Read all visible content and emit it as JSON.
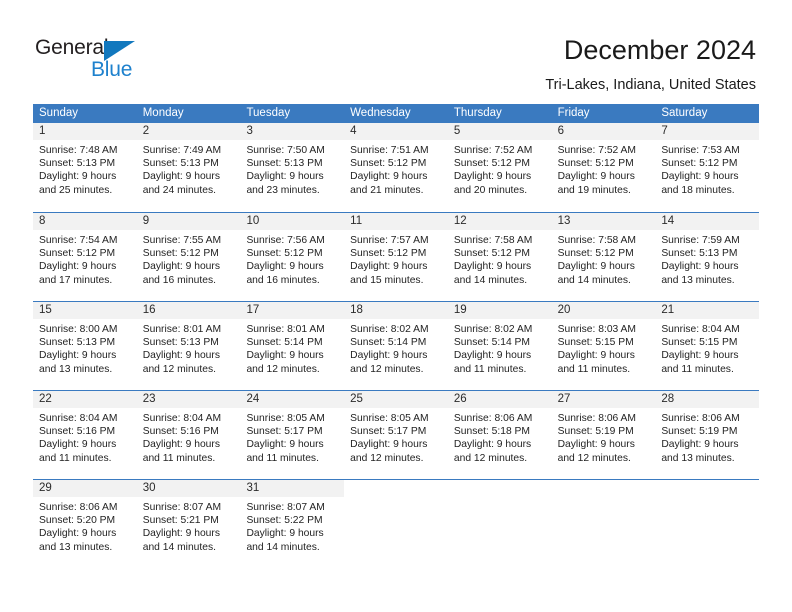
{
  "branding": {
    "name_part1": "General",
    "name_part2": "Blue"
  },
  "header": {
    "title": "December 2024",
    "subtitle": "Tri-Lakes, Indiana, United States"
  },
  "colors": {
    "header_blue": "#3a7ac0",
    "logo_blue": "#1e81cd",
    "daynum_band": "#f2f2f2"
  },
  "calendar": {
    "weekdays": [
      "Sunday",
      "Monday",
      "Tuesday",
      "Wednesday",
      "Thursday",
      "Friday",
      "Saturday"
    ],
    "weeks": [
      [
        {
          "day": "1",
          "sunrise": "Sunrise: 7:48 AM",
          "sunset": "Sunset: 5:13 PM",
          "daylight1": "Daylight: 9 hours",
          "daylight2": "and 25 minutes."
        },
        {
          "day": "2",
          "sunrise": "Sunrise: 7:49 AM",
          "sunset": "Sunset: 5:13 PM",
          "daylight1": "Daylight: 9 hours",
          "daylight2": "and 24 minutes."
        },
        {
          "day": "3",
          "sunrise": "Sunrise: 7:50 AM",
          "sunset": "Sunset: 5:13 PM",
          "daylight1": "Daylight: 9 hours",
          "daylight2": "and 23 minutes."
        },
        {
          "day": "4",
          "sunrise": "Sunrise: 7:51 AM",
          "sunset": "Sunset: 5:12 PM",
          "daylight1": "Daylight: 9 hours",
          "daylight2": "and 21 minutes."
        },
        {
          "day": "5",
          "sunrise": "Sunrise: 7:52 AM",
          "sunset": "Sunset: 5:12 PM",
          "daylight1": "Daylight: 9 hours",
          "daylight2": "and 20 minutes."
        },
        {
          "day": "6",
          "sunrise": "Sunrise: 7:52 AM",
          "sunset": "Sunset: 5:12 PM",
          "daylight1": "Daylight: 9 hours",
          "daylight2": "and 19 minutes."
        },
        {
          "day": "7",
          "sunrise": "Sunrise: 7:53 AM",
          "sunset": "Sunset: 5:12 PM",
          "daylight1": "Daylight: 9 hours",
          "daylight2": "and 18 minutes."
        }
      ],
      [
        {
          "day": "8",
          "sunrise": "Sunrise: 7:54 AM",
          "sunset": "Sunset: 5:12 PM",
          "daylight1": "Daylight: 9 hours",
          "daylight2": "and 17 minutes."
        },
        {
          "day": "9",
          "sunrise": "Sunrise: 7:55 AM",
          "sunset": "Sunset: 5:12 PM",
          "daylight1": "Daylight: 9 hours",
          "daylight2": "and 16 minutes."
        },
        {
          "day": "10",
          "sunrise": "Sunrise: 7:56 AM",
          "sunset": "Sunset: 5:12 PM",
          "daylight1": "Daylight: 9 hours",
          "daylight2": "and 16 minutes."
        },
        {
          "day": "11",
          "sunrise": "Sunrise: 7:57 AM",
          "sunset": "Sunset: 5:12 PM",
          "daylight1": "Daylight: 9 hours",
          "daylight2": "and 15 minutes."
        },
        {
          "day": "12",
          "sunrise": "Sunrise: 7:58 AM",
          "sunset": "Sunset: 5:12 PM",
          "daylight1": "Daylight: 9 hours",
          "daylight2": "and 14 minutes."
        },
        {
          "day": "13",
          "sunrise": "Sunrise: 7:58 AM",
          "sunset": "Sunset: 5:12 PM",
          "daylight1": "Daylight: 9 hours",
          "daylight2": "and 14 minutes."
        },
        {
          "day": "14",
          "sunrise": "Sunrise: 7:59 AM",
          "sunset": "Sunset: 5:13 PM",
          "daylight1": "Daylight: 9 hours",
          "daylight2": "and 13 minutes."
        }
      ],
      [
        {
          "day": "15",
          "sunrise": "Sunrise: 8:00 AM",
          "sunset": "Sunset: 5:13 PM",
          "daylight1": "Daylight: 9 hours",
          "daylight2": "and 13 minutes."
        },
        {
          "day": "16",
          "sunrise": "Sunrise: 8:01 AM",
          "sunset": "Sunset: 5:13 PM",
          "daylight1": "Daylight: 9 hours",
          "daylight2": "and 12 minutes."
        },
        {
          "day": "17",
          "sunrise": "Sunrise: 8:01 AM",
          "sunset": "Sunset: 5:14 PM",
          "daylight1": "Daylight: 9 hours",
          "daylight2": "and 12 minutes."
        },
        {
          "day": "18",
          "sunrise": "Sunrise: 8:02 AM",
          "sunset": "Sunset: 5:14 PM",
          "daylight1": "Daylight: 9 hours",
          "daylight2": "and 12 minutes."
        },
        {
          "day": "19",
          "sunrise": "Sunrise: 8:02 AM",
          "sunset": "Sunset: 5:14 PM",
          "daylight1": "Daylight: 9 hours",
          "daylight2": "and 11 minutes."
        },
        {
          "day": "20",
          "sunrise": "Sunrise: 8:03 AM",
          "sunset": "Sunset: 5:15 PM",
          "daylight1": "Daylight: 9 hours",
          "daylight2": "and 11 minutes."
        },
        {
          "day": "21",
          "sunrise": "Sunrise: 8:04 AM",
          "sunset": "Sunset: 5:15 PM",
          "daylight1": "Daylight: 9 hours",
          "daylight2": "and 11 minutes."
        }
      ],
      [
        {
          "day": "22",
          "sunrise": "Sunrise: 8:04 AM",
          "sunset": "Sunset: 5:16 PM",
          "daylight1": "Daylight: 9 hours",
          "daylight2": "and 11 minutes."
        },
        {
          "day": "23",
          "sunrise": "Sunrise: 8:04 AM",
          "sunset": "Sunset: 5:16 PM",
          "daylight1": "Daylight: 9 hours",
          "daylight2": "and 11 minutes."
        },
        {
          "day": "24",
          "sunrise": "Sunrise: 8:05 AM",
          "sunset": "Sunset: 5:17 PM",
          "daylight1": "Daylight: 9 hours",
          "daylight2": "and 11 minutes."
        },
        {
          "day": "25",
          "sunrise": "Sunrise: 8:05 AM",
          "sunset": "Sunset: 5:17 PM",
          "daylight1": "Daylight: 9 hours",
          "daylight2": "and 12 minutes."
        },
        {
          "day": "26",
          "sunrise": "Sunrise: 8:06 AM",
          "sunset": "Sunset: 5:18 PM",
          "daylight1": "Daylight: 9 hours",
          "daylight2": "and 12 minutes."
        },
        {
          "day": "27",
          "sunrise": "Sunrise: 8:06 AM",
          "sunset": "Sunset: 5:19 PM",
          "daylight1": "Daylight: 9 hours",
          "daylight2": "and 12 minutes."
        },
        {
          "day": "28",
          "sunrise": "Sunrise: 8:06 AM",
          "sunset": "Sunset: 5:19 PM",
          "daylight1": "Daylight: 9 hours",
          "daylight2": "and 13 minutes."
        }
      ],
      [
        {
          "day": "29",
          "sunrise": "Sunrise: 8:06 AM",
          "sunset": "Sunset: 5:20 PM",
          "daylight1": "Daylight: 9 hours",
          "daylight2": "and 13 minutes."
        },
        {
          "day": "30",
          "sunrise": "Sunrise: 8:07 AM",
          "sunset": "Sunset: 5:21 PM",
          "daylight1": "Daylight: 9 hours",
          "daylight2": "and 14 minutes."
        },
        {
          "day": "31",
          "sunrise": "Sunrise: 8:07 AM",
          "sunset": "Sunset: 5:22 PM",
          "daylight1": "Daylight: 9 hours",
          "daylight2": "and 14 minutes."
        },
        {
          "day": "",
          "sunrise": "",
          "sunset": "",
          "daylight1": "",
          "daylight2": ""
        },
        {
          "day": "",
          "sunrise": "",
          "sunset": "",
          "daylight1": "",
          "daylight2": ""
        },
        {
          "day": "",
          "sunrise": "",
          "sunset": "",
          "daylight1": "",
          "daylight2": ""
        },
        {
          "day": "",
          "sunrise": "",
          "sunset": "",
          "daylight1": "",
          "daylight2": ""
        }
      ]
    ]
  }
}
